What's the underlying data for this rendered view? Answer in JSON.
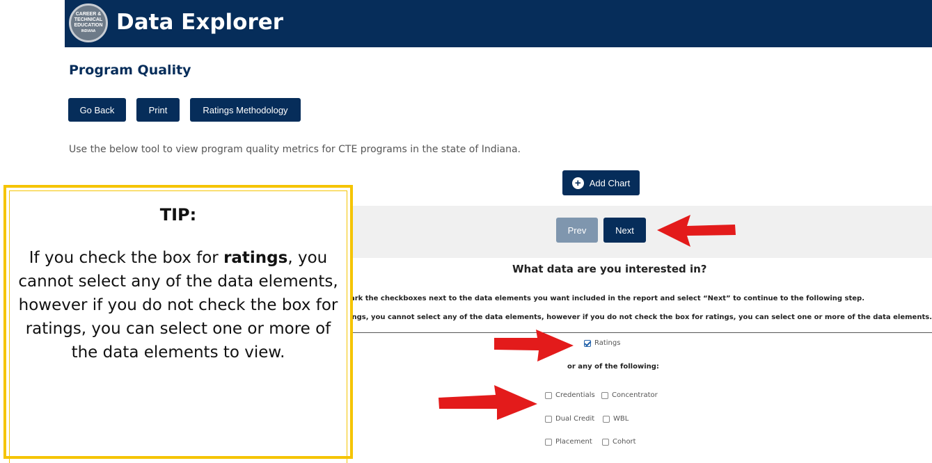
{
  "header": {
    "app_title": "Data Explorer",
    "logo_text_line1": "CAREER &",
    "logo_text_line2": "TECHNICAL",
    "logo_text_line3": "EDUCATION",
    "logo_text_line4": "INDIANA"
  },
  "page": {
    "section_title": "Program Quality",
    "intro_text": "Use the below tool to view program quality metrics for CTE programs in the state of Indiana."
  },
  "toolbar": {
    "go_back_label": "Go Back",
    "print_label": "Print",
    "ratings_methodology_label": "Ratings Methodology",
    "add_chart_label": "Add Chart"
  },
  "wizard": {
    "prev_label": "Prev",
    "next_label": "Next",
    "question": "What data are you interested in?",
    "instruction_1": "Mark the checkboxes next to the data elements you want included in the report and select “Next” to continue to the following step.",
    "instruction_2": "e box for ratings, you cannot select any of the data elements, however if you do not check the box for ratings, you can select one or more of the data elements.",
    "ratings_label": "Ratings",
    "ratings_checked": true,
    "or_label": "or any of the following:",
    "options": [
      {
        "label": "Credentials",
        "checked": false
      },
      {
        "label": "Concentrator",
        "checked": false
      },
      {
        "label": "Dual Credit",
        "checked": false
      },
      {
        "label": "WBL",
        "checked": false
      },
      {
        "label": "Placement",
        "checked": false
      },
      {
        "label": "Cohort",
        "checked": false
      }
    ]
  },
  "tip": {
    "title": "TIP:",
    "body_part1": "If you check the box for ",
    "body_bold": "ratings",
    "body_part2": ", you cannot select any of the data elements, however if you do not check the box for ratings, you can select one or more of the data elements to view."
  },
  "colors": {
    "brand_navy": "#062d5a",
    "disabled_button": "#7f96ae",
    "tip_border": "#f5c400",
    "annotation_arrow": "#e31b1b"
  }
}
